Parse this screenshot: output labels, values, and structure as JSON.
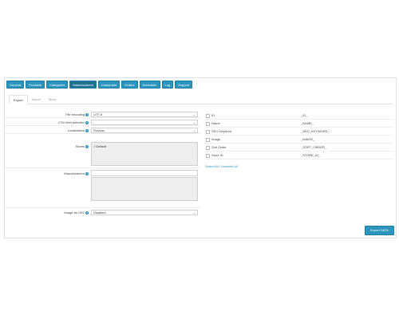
{
  "top_tabs": [
    "General",
    "Products",
    "Categories",
    "Manufacturers",
    "Customers",
    "Orders",
    "Scheduler",
    "Log",
    "Support"
  ],
  "active_top_tab": "Manufacturers",
  "sub_tabs": [
    "Export",
    "Import",
    "Mass"
  ],
  "active_sub_tab": "Export",
  "form": {
    "file_encoding": {
      "label": "File encoding",
      "value": "UTF-8"
    },
    "csv_delimiter": {
      "label": "CSV field delimiter",
      "value": ";"
    },
    "localization": {
      "label": "Localization",
      "value": "Russian"
    },
    "stores": {
      "label": "Stores",
      "checked_item": "Default"
    },
    "manufacturers": {
      "label": "Manufacturers",
      "value": ""
    },
    "image_as_url": {
      "label": "Image as URL",
      "value": "Disabled"
    }
  },
  "fields": [
    {
      "name": "ID",
      "code": "_ID_"
    },
    {
      "name": "Name",
      "code": "_NAME_"
    },
    {
      "name": "SEO Keyword",
      "code": "_SEO_KEYWORD_"
    },
    {
      "name": "Image",
      "code": "_IMAGE_"
    },
    {
      "name": "Sort Order",
      "code": "_SORT_ORDER_"
    },
    {
      "name": "Store ID",
      "code": "_STORE_ID_"
    }
  ],
  "select_all_text": "Select All / Unselect All",
  "export_button": "Export DATA",
  "colors": {
    "accent": "#2b96bd",
    "accent_dark": "#1f7392"
  }
}
